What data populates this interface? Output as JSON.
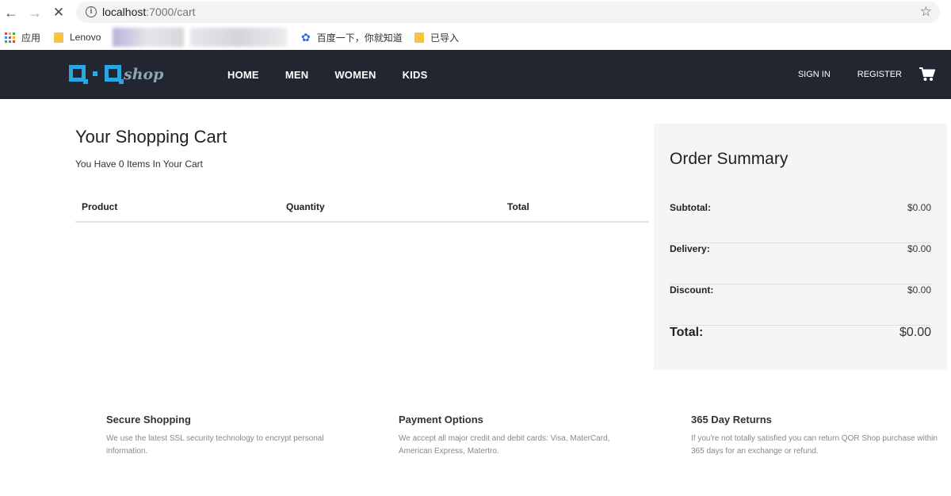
{
  "browser": {
    "url_host": "localhost",
    "url_path": ":7000/cart",
    "bookmarks": [
      {
        "label": "应用"
      },
      {
        "label": "Lenovo"
      },
      {
        "label": "百度一下，你就知道"
      },
      {
        "label": "已导入"
      }
    ]
  },
  "header": {
    "logo_word": "shop",
    "nav": [
      "HOME",
      "MEN",
      "WOMEN",
      "KIDS"
    ],
    "sign_in": "SIGN IN",
    "register": "REGISTER"
  },
  "cart": {
    "title": "Your Shopping Cart",
    "count_text": "You Have 0 Items In Your Cart",
    "columns": [
      "Product",
      "Quantity",
      "Total"
    ]
  },
  "summary": {
    "title": "Order Summary",
    "rows": [
      {
        "label": "Subtotal:",
        "value": "$0.00"
      },
      {
        "label": "Delivery:",
        "value": "$0.00"
      },
      {
        "label": "Discount:",
        "value": "$0.00"
      }
    ],
    "total_label": "Total:",
    "total_value": "$0.00"
  },
  "features": [
    {
      "title": "Secure Shopping",
      "text": "We use the latest SSL security technology to encrypt personal information."
    },
    {
      "title": "Payment Options",
      "text": "We accept all major credit and debit cards: Visa, MaterCard, American Express, Matertro."
    },
    {
      "title": "365 Day Returns",
      "text": "If you're not totally satisfied you can return QOR Shop purchase within 365 days for an exchange or refund."
    }
  ],
  "colors": {
    "header_bg": "#222631",
    "logo_accent": "#2aa7e0",
    "summary_bg": "#f5f5f5"
  }
}
